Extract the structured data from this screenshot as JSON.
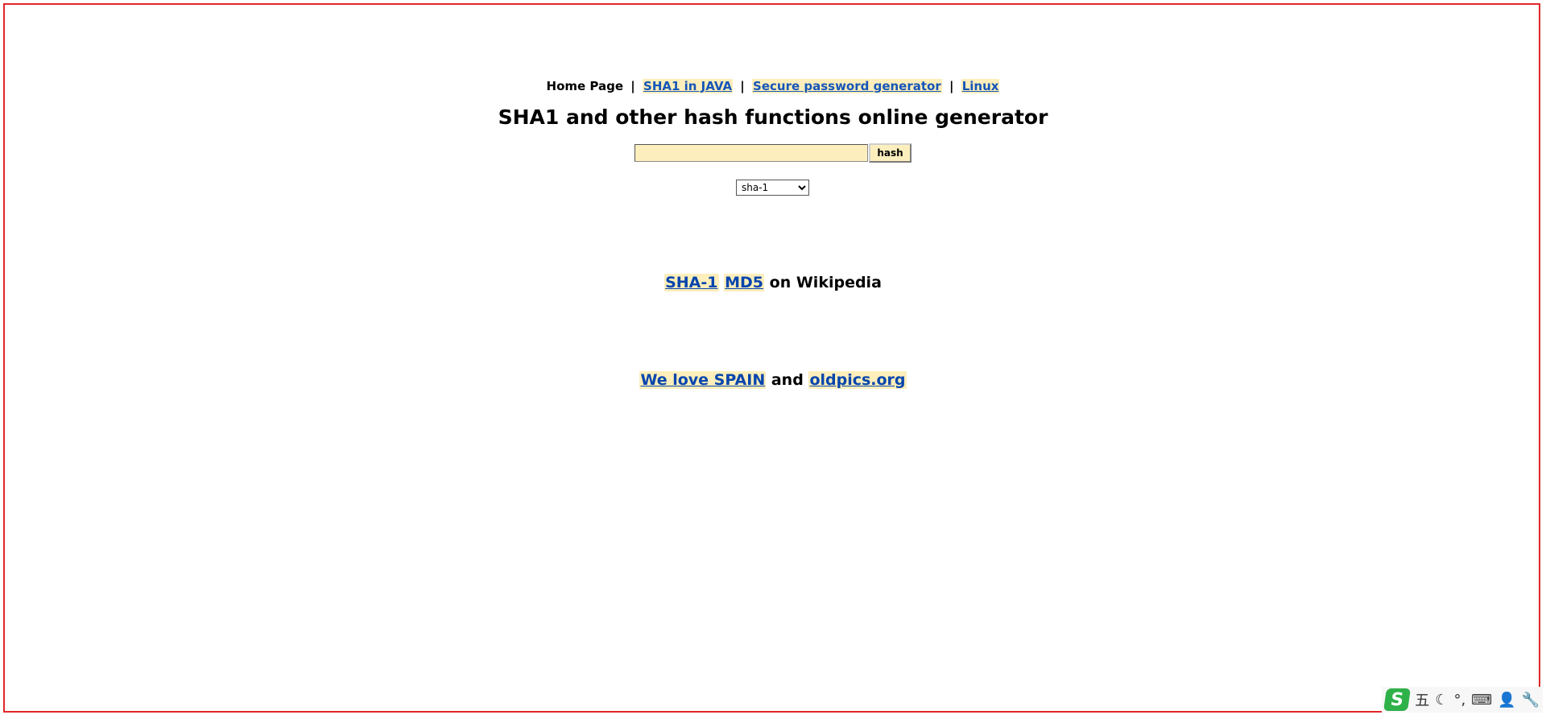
{
  "nav": {
    "home": "Home Page",
    "separator": "|",
    "links": [
      {
        "label": "SHA1 in JAVA"
      },
      {
        "label": "Secure password generator"
      },
      {
        "label": "Linux"
      }
    ]
  },
  "title": "SHA1 and other hash functions online generator",
  "form": {
    "input_value": "",
    "button_label": "hash",
    "select_value": "sha-1"
  },
  "wiki": {
    "link1": "SHA-1",
    "link2": "MD5",
    "text": "on Wikipedia"
  },
  "footer": {
    "link1": "We love SPAIN",
    "text": "and",
    "link2": "oldpics.org"
  },
  "tray": {
    "logo": "S",
    "icons": [
      "五",
      "☾",
      "°,",
      "⌨",
      "👤",
      "🔧"
    ]
  },
  "colors": {
    "frame_border": "#e0262b",
    "link_highlight": "#fdeebb",
    "link_text": "#1556b8",
    "ime_logo": "#2fb14a"
  }
}
